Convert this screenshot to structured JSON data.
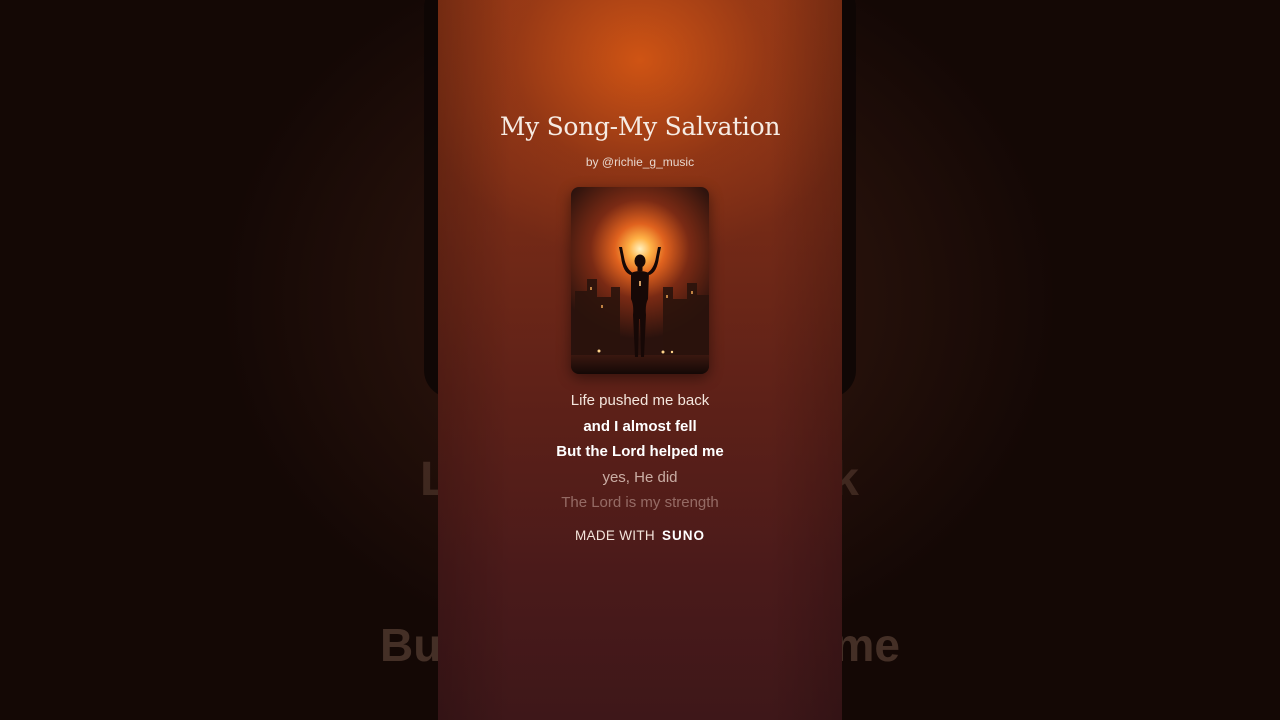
{
  "song": {
    "title": "My Song-My Salvation",
    "artist": "by @richie_g_music"
  },
  "cover_art": {
    "icon": "silhouette-raised-hands-sunset-icon"
  },
  "lyrics": [
    {
      "text": "Life pushed me back",
      "style": "normal"
    },
    {
      "text": "and I almost fell",
      "style": "bold"
    },
    {
      "text": "But the Lord helped me",
      "style": "bold"
    },
    {
      "text": "yes, He did",
      "style": "dim"
    },
    {
      "text": "The Lord is my strength",
      "style": "faint"
    }
  ],
  "footer": {
    "made_with": "MADE WITH",
    "brand": "SUNO"
  },
  "backdrop": {
    "line_1_left": "L",
    "line_1_right": "k",
    "line_2_left": "Bu",
    "line_2_right": "me"
  },
  "colors": {
    "accent_glow": "#e0621e",
    "panel_top": "#8a3316",
    "panel_bottom": "#3e1719"
  }
}
